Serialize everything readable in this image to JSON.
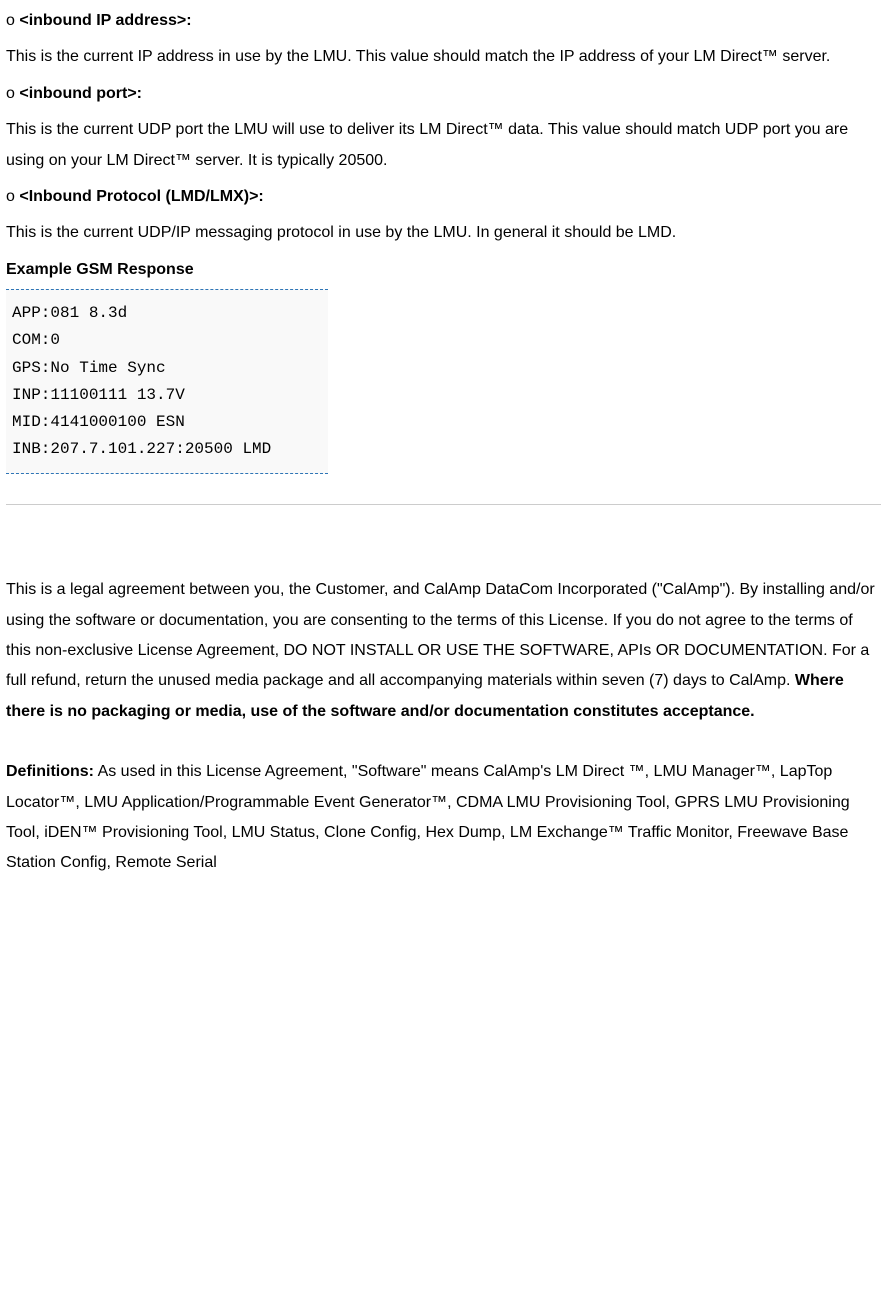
{
  "items": [
    {
      "prefix": "o ",
      "label": "<inbound IP address>:",
      "desc": "This is the current IP address in use by the LMU. This value should match the IP address of your LM Direct™ server."
    },
    {
      "prefix": "o ",
      "label": "<inbound port>:",
      "desc": "This is the current UDP port the LMU will use to deliver its LM Direct™ data. This value should match UDP port you are using on your LM Direct™ server. It is typically 20500."
    },
    {
      "prefix": "o ",
      "label": "<Inbound Protocol (LMD/LMX)>:",
      "desc": "This is the current UDP/IP messaging protocol in use by the LMU. In general it should be LMD."
    }
  ],
  "example_heading": "Example GSM Response",
  "code": "APP:081 8.3d\nCOM:0\nGPS:No Time Sync\nINP:11100111 13.7V\nMID:4141000100 ESN\nINB:207.7.101.227:20500 LMD",
  "legal": {
    "intro_plain": "This is a legal agreement between you, the Customer, and CalAmp DataCom Incorporated (\"CalAmp\"). By installing and/or using the software or documentation, you are consenting to the terms of this License. If you do not agree to the terms of this non-exclusive License Agreement, DO NOT INSTALL OR USE THE SOFTWARE, APIs OR DOCUMENTATION. For a full refund, return the unused media package and all accompanying materials within seven (7) days to CalAmp. ",
    "intro_bold": "Where there is no packaging or media, use of the software and/or documentation constitutes acceptance.",
    "defs_label": "Definitions:",
    "defs_text": " As used in this License Agreement, \"Software\" means CalAmp's LM Direct ™, LMU Manager™, LapTop Locator™, LMU Application/Programmable Event Generator™, CDMA LMU Provisioning Tool, GPRS LMU Provisioning Tool, iDEN™ Provisioning Tool, LMU Status, Clone Config, Hex Dump, LM Exchange™ Traffic Monitor, Freewave Base Station Config, Remote Serial"
  }
}
